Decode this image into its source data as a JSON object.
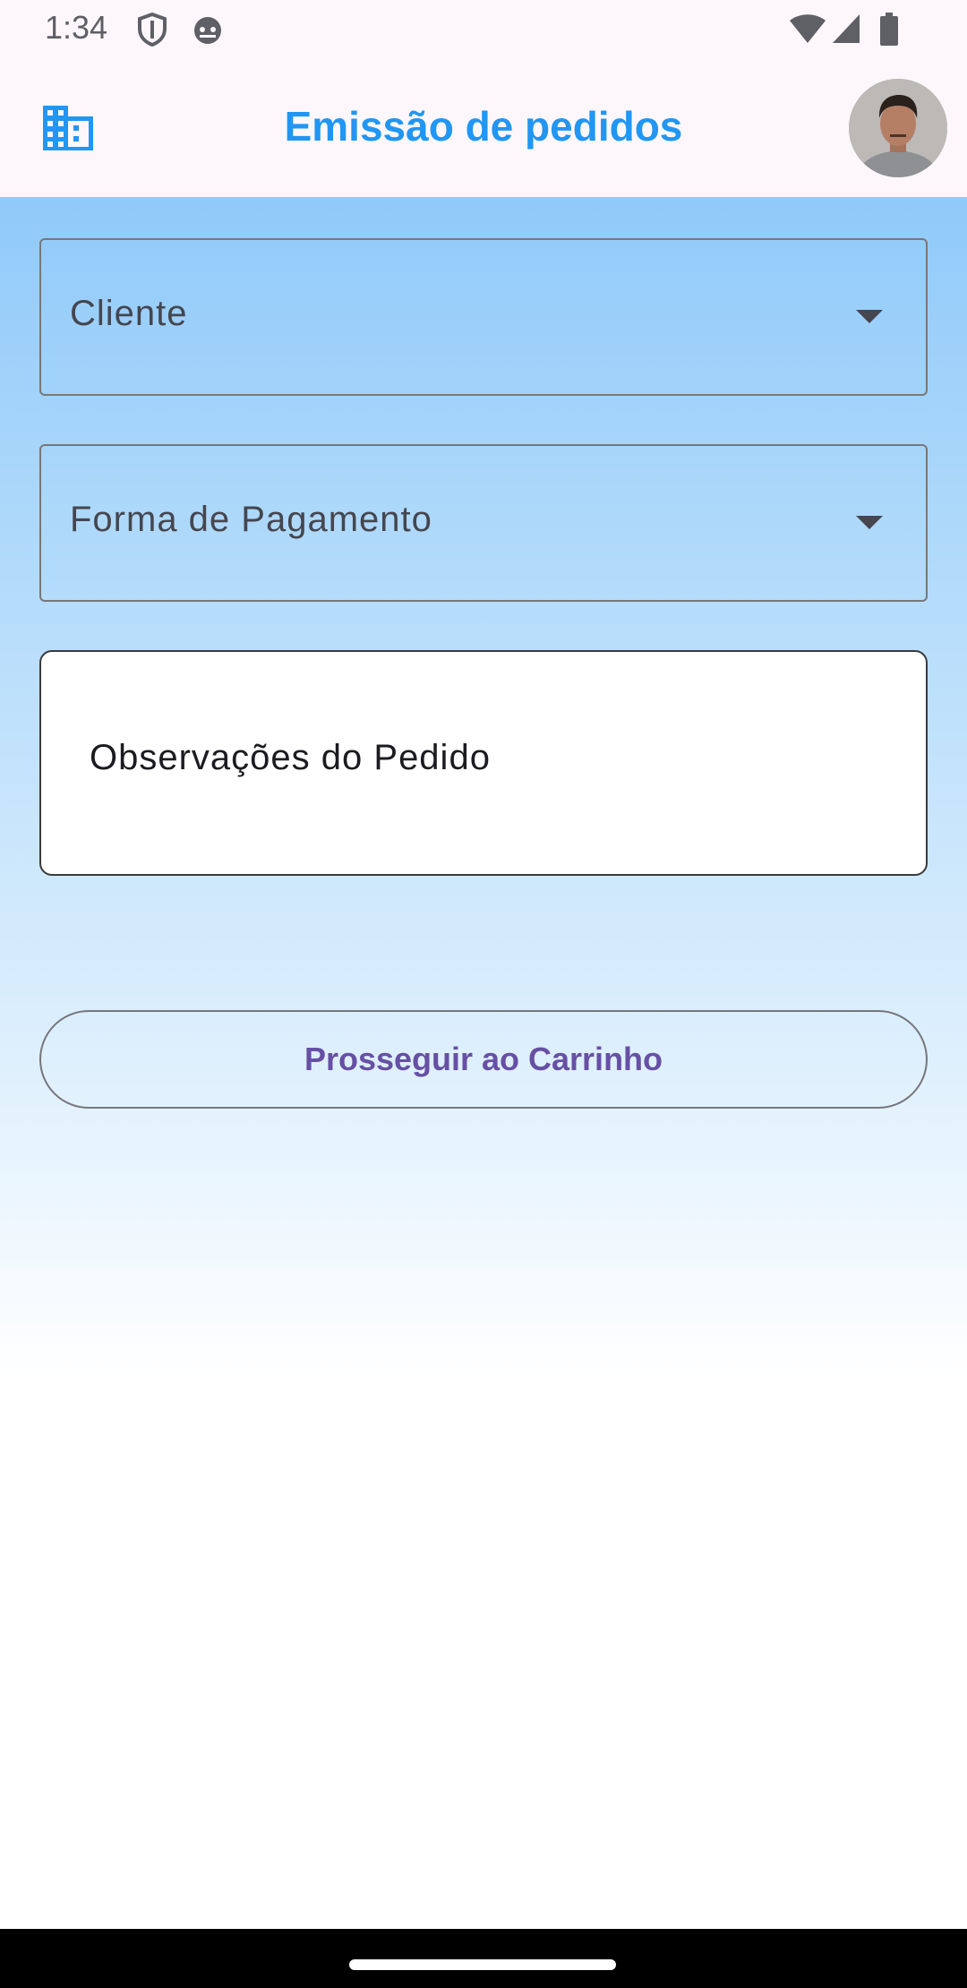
{
  "status_bar": {
    "time": "1:34",
    "icons": [
      "shield-icon",
      "android-debug-icon",
      "wifi-icon",
      "cell-signal-icon",
      "battery-icon"
    ]
  },
  "app_bar": {
    "title": "Emissão de pedidos",
    "leading_icon": "building-icon",
    "title_color": "#2196f3"
  },
  "form": {
    "cliente_label": "Cliente",
    "pagamento_label": "Forma de Pagamento",
    "observacoes_label": "Observações do Pedido",
    "submit_label": "Prosseguir ao Carrinho"
  },
  "colors": {
    "accent": "#2196f3",
    "button_text": "#6750a4",
    "gradient_top": "#90caf9",
    "gradient_bottom": "#ffffff"
  }
}
